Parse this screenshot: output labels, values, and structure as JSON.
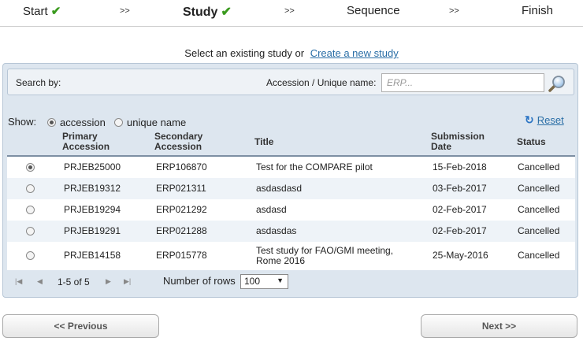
{
  "wizard": {
    "steps": [
      {
        "label": "Start",
        "done": true
      },
      {
        "label": "Study",
        "done": true,
        "active": true
      },
      {
        "label": "Sequence",
        "done": false
      },
      {
        "label": "Finish",
        "done": false
      }
    ],
    "separator": ">>",
    "check_glyph": "✔"
  },
  "intro": {
    "text": "Select an existing study",
    "or": "or",
    "create_link": "Create a new study"
  },
  "search": {
    "search_by": "Search by:",
    "field_label": "Accession / Unique name:",
    "placeholder": "ERP...",
    "value": ""
  },
  "show": {
    "label": "Show:",
    "options": [
      "accession",
      "unique name"
    ],
    "selected": "accession"
  },
  "reset_label": "Reset",
  "table": {
    "headers": {
      "primary": [
        "Primary",
        "Accession"
      ],
      "secondary": [
        "Secondary",
        "Accession"
      ],
      "title": "Title",
      "date": [
        "Submission",
        "Date"
      ],
      "status": "Status"
    },
    "rows": [
      {
        "selected": true,
        "primary": "PRJEB25000",
        "secondary": "ERP106870",
        "title": [
          "Test for the COMPARE pilot"
        ],
        "date": "15-Feb-2018",
        "status": "Cancelled"
      },
      {
        "selected": false,
        "primary": "PRJEB19312",
        "secondary": "ERP021311",
        "title": [
          "asdasdasd"
        ],
        "date": "03-Feb-2017",
        "status": "Cancelled"
      },
      {
        "selected": false,
        "primary": "PRJEB19294",
        "secondary": "ERP021292",
        "title": [
          "asdasd"
        ],
        "date": "02-Feb-2017",
        "status": "Cancelled"
      },
      {
        "selected": false,
        "primary": "PRJEB19291",
        "secondary": "ERP021288",
        "title": [
          "asdasdas"
        ],
        "date": "02-Feb-2017",
        "status": "Cancelled"
      },
      {
        "selected": false,
        "primary": "PRJEB14158",
        "secondary": "ERP015778",
        "title": [
          "Test study for FAO/GMI meeting,",
          "Rome 2016"
        ],
        "date": "25-May-2016",
        "status": "Cancelled"
      }
    ]
  },
  "pager": {
    "range": "1-5 of 5",
    "rows_label": "Number of rows",
    "rows_value": "100"
  },
  "nav": {
    "previous": "<< Previous",
    "next": "Next >>"
  },
  "colors": {
    "accent_link": "#2a6ea6",
    "check": "#3a9a1e",
    "panel_bg": "#dde6ef"
  }
}
